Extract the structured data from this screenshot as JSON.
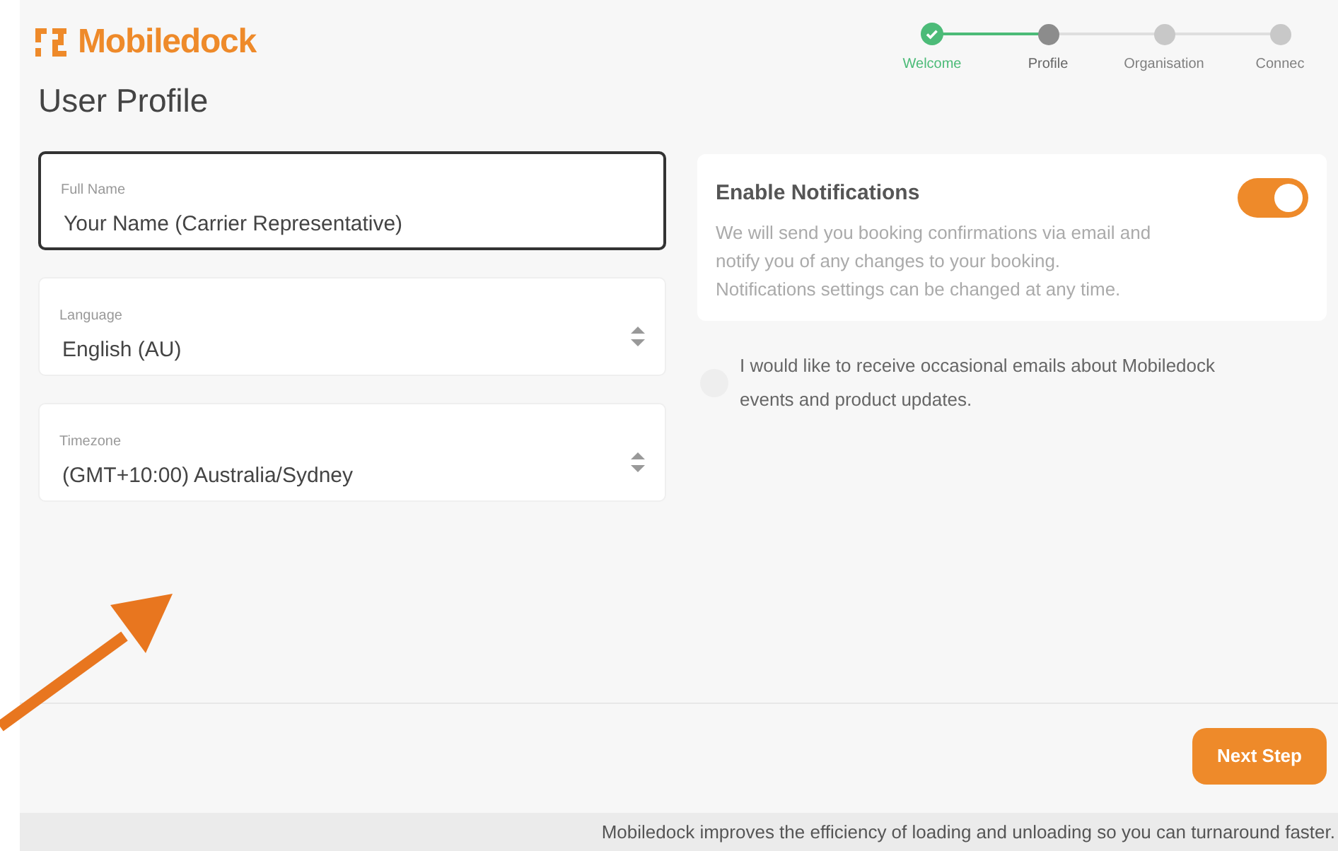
{
  "logo": {
    "text": "Mobiledock"
  },
  "stepper": [
    {
      "label": "Welcome",
      "completed": true,
      "selected": false
    },
    {
      "label": "Profile",
      "completed": false,
      "selected": true
    },
    {
      "label": "Organisation",
      "completed": false,
      "selected": false
    },
    {
      "label": "Connec",
      "completed": false,
      "selected": false
    }
  ],
  "page_title": "User Profile",
  "fields": [
    {
      "kind": "text",
      "label": "Full Name",
      "value": "Your Name (Carrier Representative)",
      "focused": true
    },
    {
      "kind": "select",
      "label": "Language",
      "value": "English (AU)",
      "focused": false
    },
    {
      "kind": "select",
      "label": "Timezone",
      "value": "(GMT+10:00) Australia/Sydney",
      "focused": false
    }
  ],
  "notifications": {
    "title": "Enable Notifications",
    "description": [
      "We will send you booking confirmations via email and",
      "notify you of any changes to your booking.",
      "Notifications settings can be changed at any time."
    ],
    "on": true
  },
  "marketing_opt_in": {
    "label": "I would like to receive occasional emails about Mobiledock events and product updates.",
    "checked": false
  },
  "next_button": "Next Step",
  "footer": "Mobiledock improves the efficiency of loading and unloading so you can turnaround faster."
}
